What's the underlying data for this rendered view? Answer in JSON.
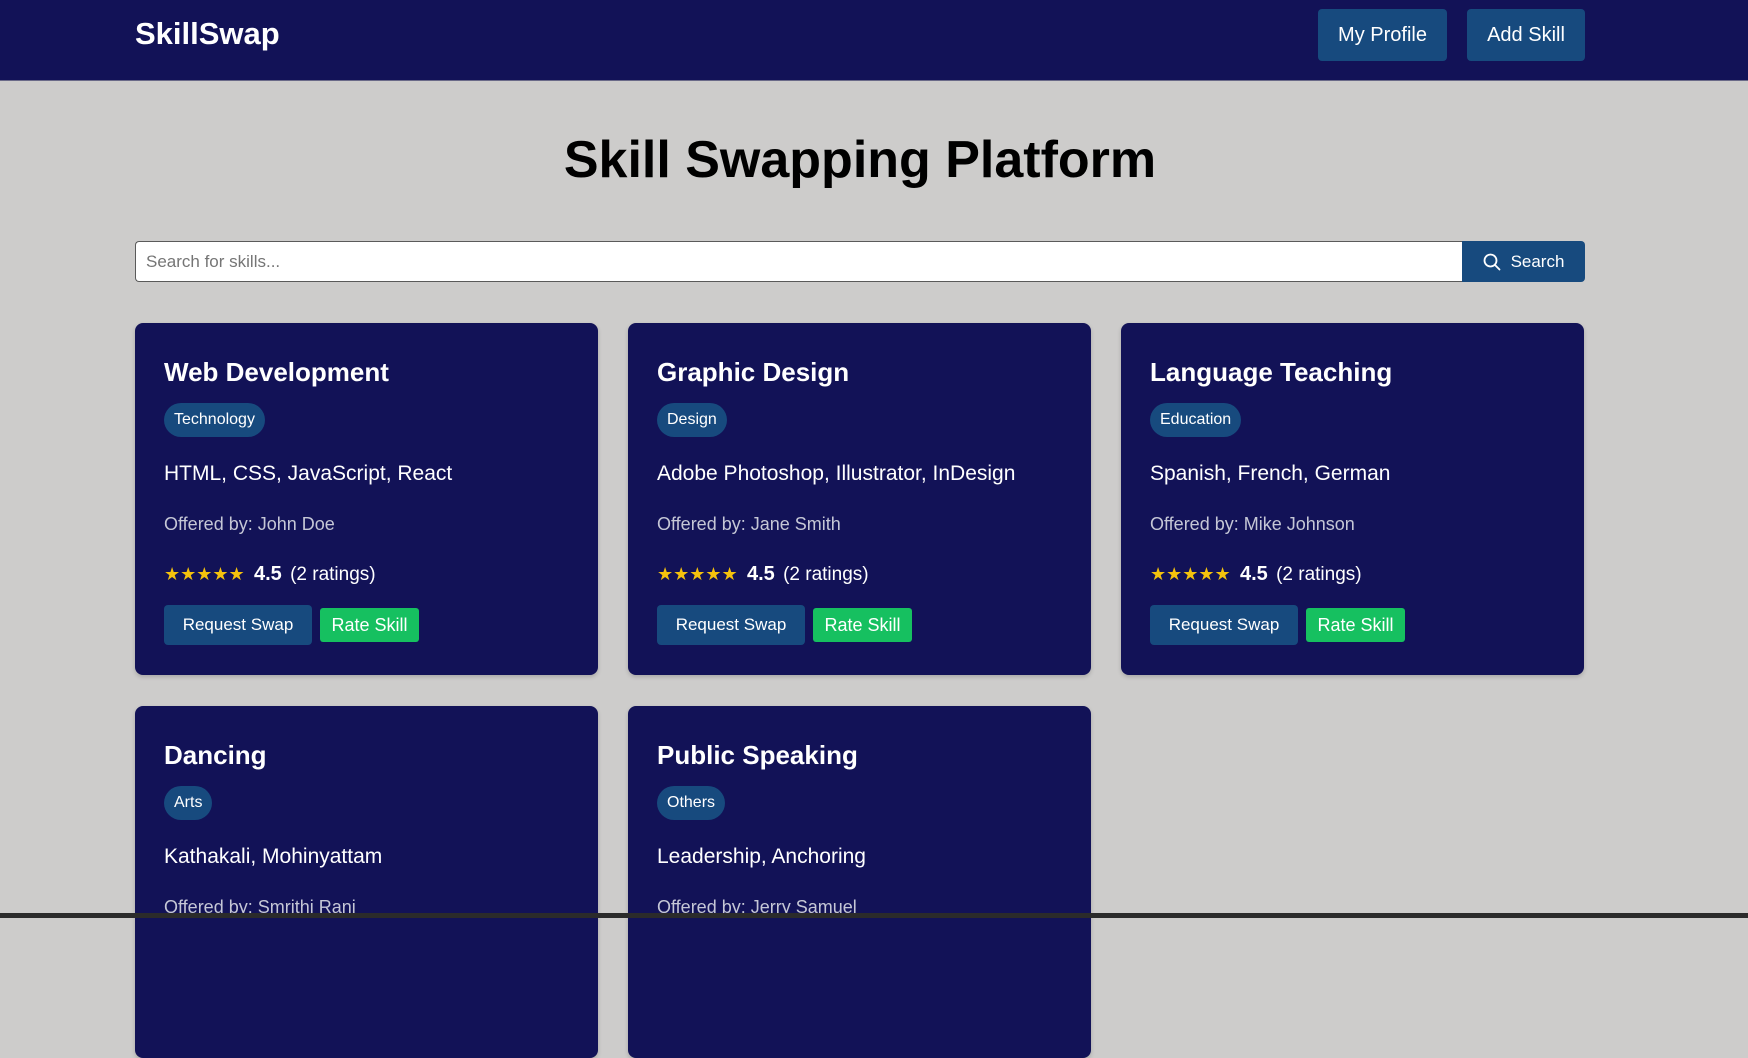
{
  "header": {
    "brand": "SkillSwap",
    "profile_label": "My Profile",
    "add_skill_label": "Add Skill"
  },
  "page": {
    "title": "Skill Swapping Platform"
  },
  "search": {
    "placeholder": "Search for skills...",
    "value": "",
    "button_label": "Search"
  },
  "colors": {
    "navbar": "#121257",
    "card": "#121257",
    "primary_button": "#174a7e",
    "rate_button": "#16c060",
    "stars": "#f4c20d",
    "background": "#cdcccb"
  },
  "cards": [
    {
      "title": "Web Development",
      "category": "Technology",
      "skills": "HTML, CSS, JavaScript, React",
      "offered_by": "Offered by: John Doe",
      "stars": "★★★★★",
      "rating": "4.5",
      "rating_count": "(2 ratings)",
      "request_label": "Request Swap",
      "rate_label": "Rate Skill"
    },
    {
      "title": "Graphic Design",
      "category": "Design",
      "skills": "Adobe Photoshop, Illustrator, InDesign",
      "offered_by": "Offered by: Jane Smith",
      "stars": "★★★★★",
      "rating": "4.5",
      "rating_count": "(2 ratings)",
      "request_label": "Request Swap",
      "rate_label": "Rate Skill"
    },
    {
      "title": "Language Teaching",
      "category": "Education",
      "skills": "Spanish, French, German",
      "offered_by": "Offered by: Mike Johnson",
      "stars": "★★★★★",
      "rating": "4.5",
      "rating_count": "(2 ratings)",
      "request_label": "Request Swap",
      "rate_label": "Rate Skill"
    },
    {
      "title": "Dancing",
      "category": "Arts",
      "skills": "Kathakali, Mohinyattam",
      "offered_by": "Offered by: Smrithi Rani"
    },
    {
      "title": "Public Speaking",
      "category": "Others",
      "skills": "Leadership, Anchoring",
      "offered_by": "Offered by: Jerry Samuel"
    }
  ]
}
